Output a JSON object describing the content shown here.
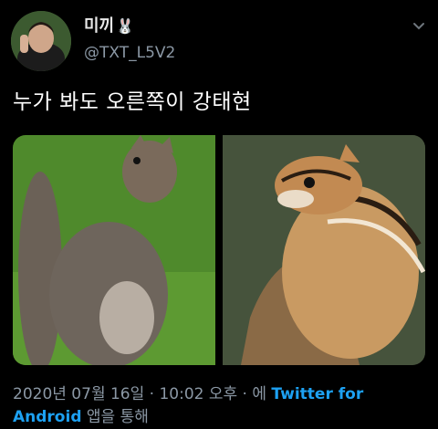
{
  "author": {
    "display_name": "미끼",
    "name_emoji": "🐰",
    "handle": "@TXT_L5V2",
    "avatar_icon": "profile-photo-person-peace-sign"
  },
  "tweet": {
    "text": "누가 봐도 오른쪽이 강태현",
    "media": [
      {
        "description_icon": "gray-squirrel-photo"
      },
      {
        "description_icon": "chipmunk-photo"
      }
    ]
  },
  "meta": {
    "timestamp": "2020년 07월 16일 · 10:02 오후 · 에",
    "source_link": "Twitter for Android",
    "source_suffix": "앱을 통해"
  },
  "colors": {
    "background": "#000000",
    "secondary_text": "#8b98a5",
    "link": "#1da1f2"
  }
}
